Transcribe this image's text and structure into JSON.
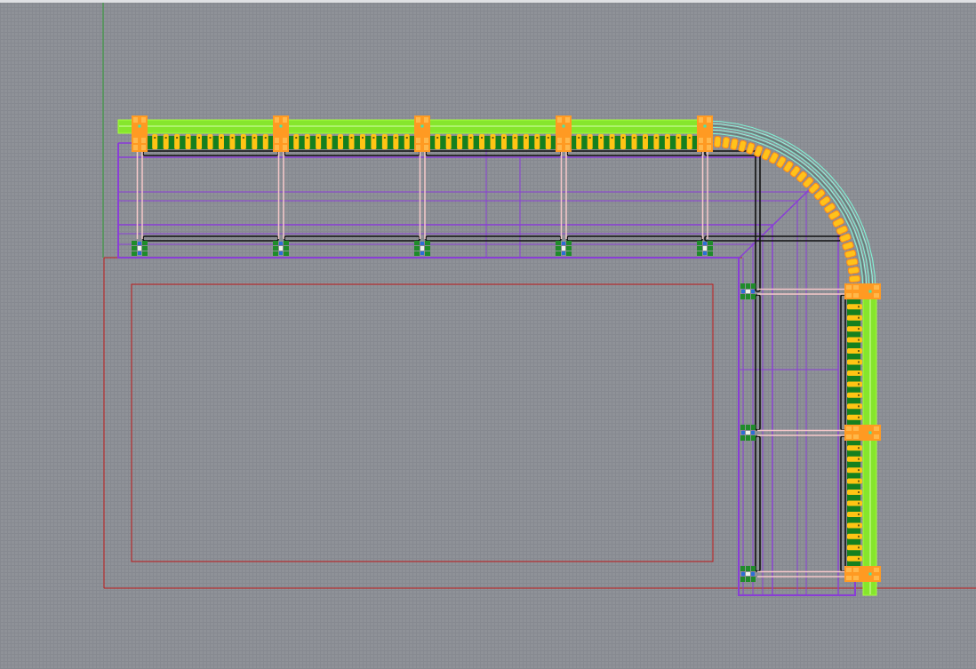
{
  "conveyor": {
    "sections": [
      {
        "kind": "straight"
      },
      {
        "kind": "straight"
      },
      {
        "kind": "straight"
      },
      {
        "kind": "straight"
      },
      {
        "kind": "curve"
      },
      {
        "kind": "straight"
      },
      {
        "kind": "straight"
      }
    ]
  }
}
